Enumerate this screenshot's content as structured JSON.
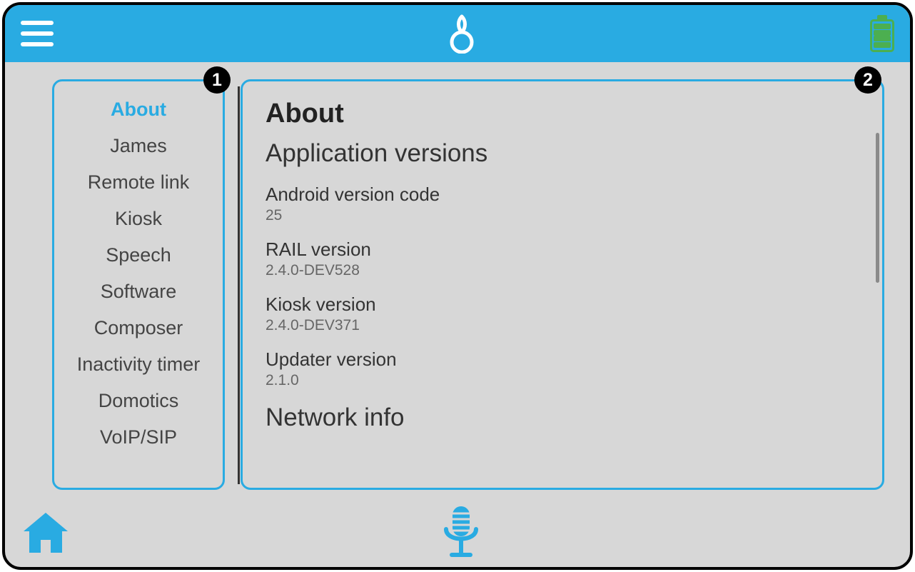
{
  "colors": {
    "accent": "#29abe2",
    "battery": "#4caf50"
  },
  "callouts": {
    "sidebar": "1",
    "content": "2"
  },
  "sidebar": {
    "items": [
      {
        "label": "About",
        "active": true
      },
      {
        "label": "James",
        "active": false
      },
      {
        "label": "Remote link",
        "active": false
      },
      {
        "label": "Kiosk",
        "active": false
      },
      {
        "label": "Speech",
        "active": false
      },
      {
        "label": "Software",
        "active": false
      },
      {
        "label": "Composer",
        "active": false
      },
      {
        "label": "Inactivity timer",
        "active": false
      },
      {
        "label": "Domotics",
        "active": false
      },
      {
        "label": "VoIP/SIP",
        "active": false
      }
    ]
  },
  "content": {
    "title": "About",
    "section1_title": "Application versions",
    "items": [
      {
        "k": "Android version code",
        "v": "25"
      },
      {
        "k": "RAIL version",
        "v": "2.4.0-DEV528"
      },
      {
        "k": "Kiosk version",
        "v": "2.4.0-DEV371"
      },
      {
        "k": "Updater version",
        "v": "2.1.0"
      }
    ],
    "section2_title": "Network info"
  }
}
